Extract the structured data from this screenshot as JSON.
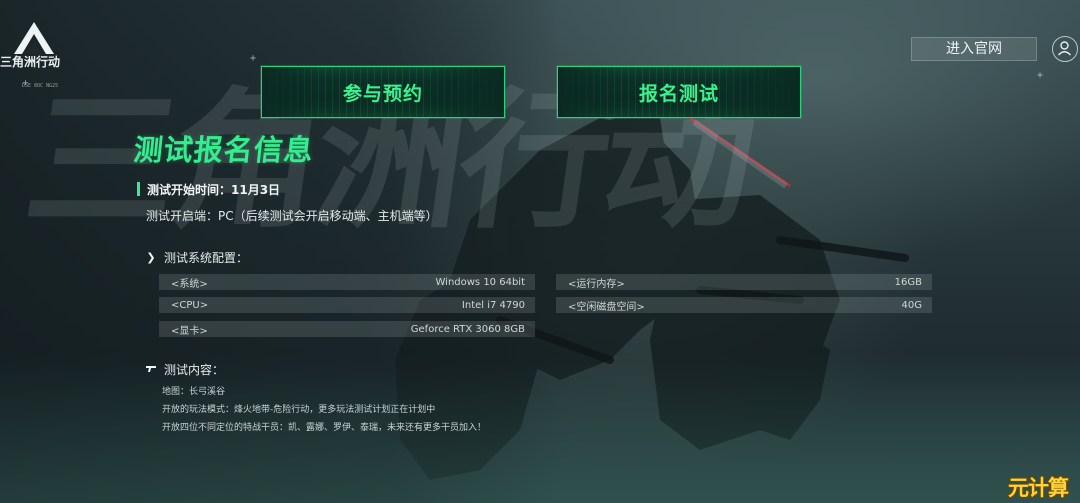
{
  "brand": {
    "logo_text": "三角洲行动",
    "logo_small": "DSE 8OC NG25"
  },
  "background": {
    "giant_text": "三角洲行动"
  },
  "header": {
    "enter_site_label": "进入官网",
    "user_icon": "user-icon"
  },
  "actions": {
    "reserve_label": "参与预约",
    "signup_label": "报名测试"
  },
  "main": {
    "title": "测试报名信息",
    "date_text": "测试开始时间：11月3日",
    "platform_text": "测试开启端：PC（后续测试会开启移动端、主机端等）",
    "system_section_title": "测试系统配置：",
    "specs": [
      {
        "key": "<系统>",
        "value": "Windows 10 64bit"
      },
      {
        "key": "<运行内存>",
        "value": "16GB"
      },
      {
        "key": "<CPU>",
        "value": "Intel i7 4790"
      },
      {
        "key": "<空闲磁盘空间>",
        "value": "40G"
      },
      {
        "key": "<显卡>",
        "value": "Geforce RTX 3060 8GB"
      }
    ],
    "content_section_title": "测试内容：",
    "content_lines": [
      "地图：长弓溪谷",
      "开放的玩法模式：烽火地带-危险行动，更多玩法测试计划正在计划中",
      "开放四位不同定位的特战干员：凯、露娜、罗伊、泰瑞，未来还有更多干员加入！"
    ]
  },
  "watermark": "元计算",
  "colors": {
    "accent_green": "#35ec8e",
    "button_border": "#27d47d",
    "watermark_yellow": "#ffd43a"
  }
}
